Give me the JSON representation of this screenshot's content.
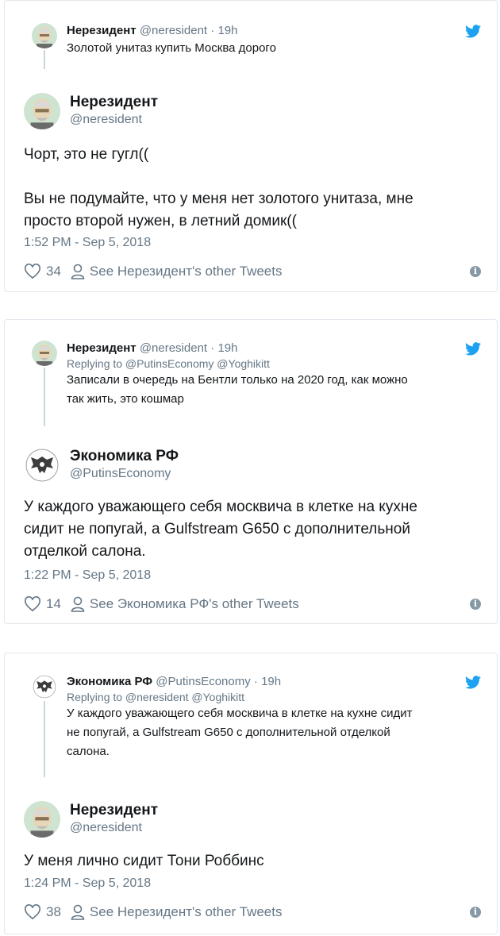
{
  "tweets": [
    {
      "reply": {
        "name": "Нерезидент",
        "handle": "@neresident",
        "dot": "·",
        "time": "19h",
        "replying": "",
        "text": "Золотой унитаз купить Москва дорого"
      },
      "main": {
        "name": "Нерезидент",
        "handle": "@neresident",
        "text_lines": [
          "Чорт, это не гугл((",
          "",
          "Вы не подумайте, что у меня нет золотого унитаза, мне",
          "просто второй нужен, в летний домик(("
        ],
        "timestamp": "1:52 PM - Sep 5, 2018",
        "likes": "34",
        "other_tweets": "See Нерезидент's other Tweets"
      }
    },
    {
      "reply": {
        "name": "Нерезидент",
        "handle": "@neresident",
        "dot": "·",
        "time": "19h",
        "replying": "Replying to @PutinsEconomy @Yoghikitt",
        "text_lines": [
          "Записали в очередь на Бентли только на 2020 год, как можно",
          "так жить, это кошмар"
        ]
      },
      "main": {
        "name": "Экономика РФ",
        "handle": "@PutinsEconomy",
        "text_lines": [
          "У каждого уважающего себя москвича в клетке на кухне",
          "сидит не попугай, а Gulfstream G650 с дополнительной",
          "отделкой салона."
        ],
        "timestamp": "1:22 PM - Sep 5, 2018",
        "likes": "14",
        "other_tweets": "See Экономика РФ's other Tweets"
      }
    },
    {
      "reply": {
        "name": "Экономика РФ",
        "handle": "@PutinsEconomy",
        "dot": "·",
        "time": "19h",
        "replying": "Replying to @neresident @Yoghikitt",
        "text_lines": [
          "У каждого уважающего себя москвича в клетке на кухне сидит",
          "не попугай, а Gulfstream G650 с дополнительной отделкой",
          "салона."
        ]
      },
      "main": {
        "name": "Нерезидент",
        "handle": "@neresident",
        "text_lines": [
          "У меня лично сидит Тони Роббинс"
        ],
        "timestamp": "1:24 PM - Sep 5, 2018",
        "likes": "38",
        "other_tweets": "See Нерезидент's other Tweets"
      }
    }
  ],
  "icons": {
    "brand": "twitter-bird-icon",
    "like": "heart-icon",
    "profile": "person-icon",
    "info": "info-icon"
  },
  "colors": {
    "twitter_blue": "#1da1f2",
    "secondary_text": "#657786",
    "border": "#e1e8ed"
  },
  "info_glyph": "i"
}
